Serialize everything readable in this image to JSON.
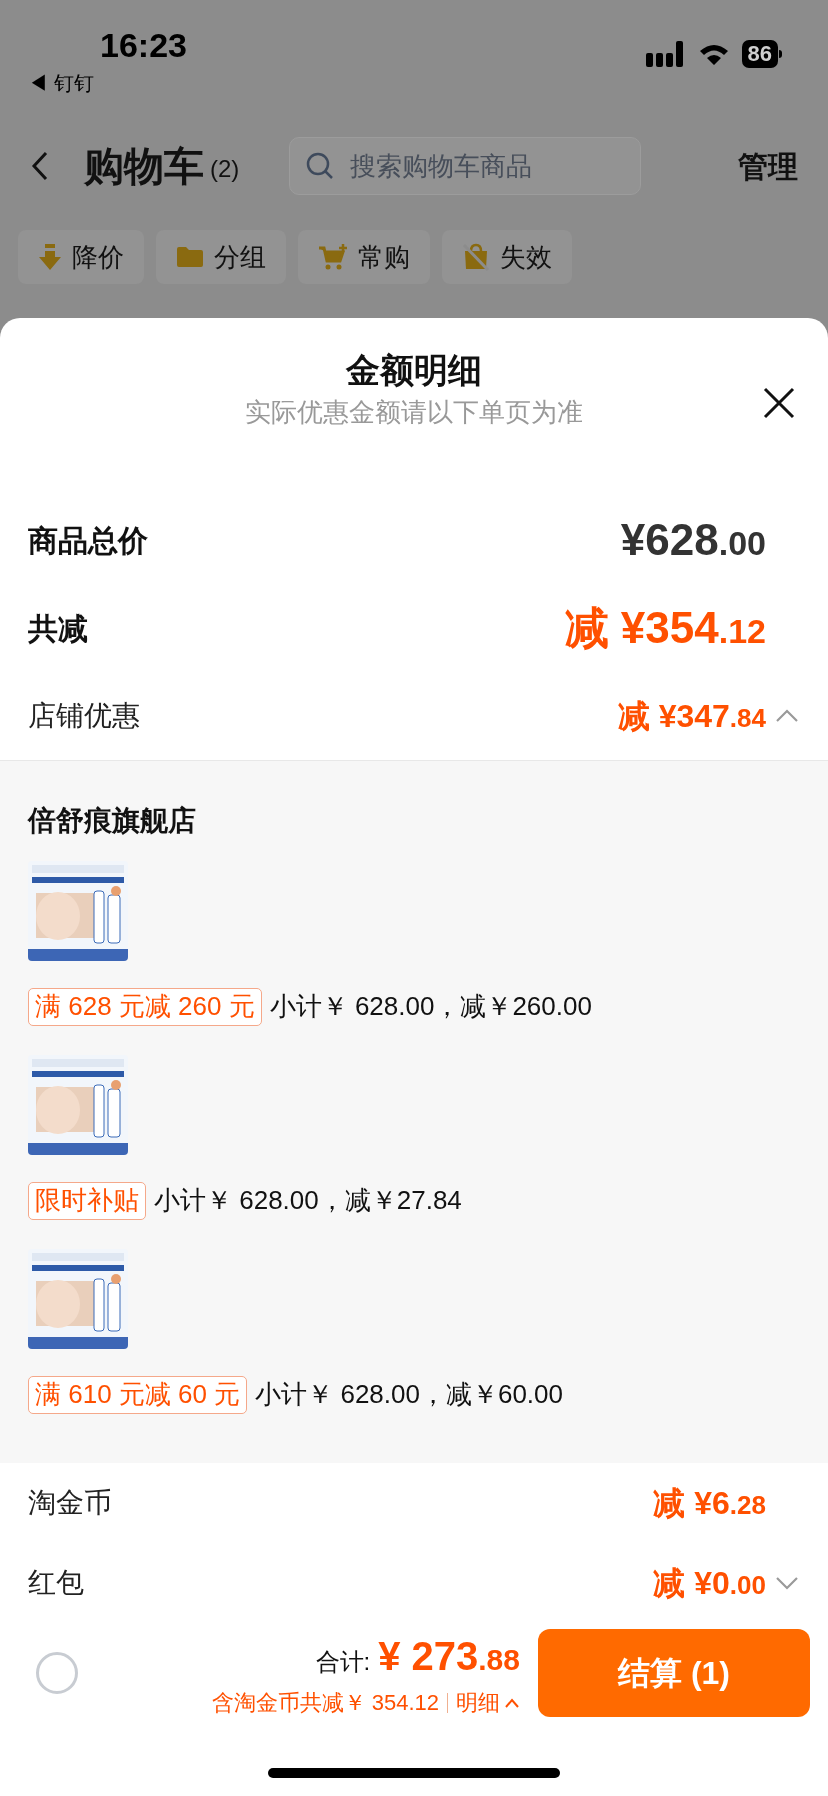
{
  "status_bar": {
    "time": "16:23",
    "back_app": "◀ 钉钉",
    "battery": "86"
  },
  "header": {
    "title": "购物车",
    "count": "(2)",
    "search": {
      "placeholder": "搜索购物车商品"
    },
    "manage": "管理"
  },
  "filters": [
    {
      "label": "降价",
      "kind": "down"
    },
    {
      "label": "分组",
      "kind": "folder"
    },
    {
      "label": "常购",
      "kind": "cart"
    },
    {
      "label": "失效",
      "kind": "invalid"
    }
  ],
  "sheet": {
    "title": "金额明细",
    "subtitle": "实际优惠金额请以下单页为准",
    "summary": [
      {
        "label": "商品总价",
        "amount": "¥628.00",
        "kind": "total"
      },
      {
        "label": "共减",
        "amount": "减 ¥354.12",
        "kind": "discount"
      },
      {
        "label": "店铺优惠",
        "amount": "减 ¥347.84",
        "kind": "sub",
        "expanded": true
      }
    ],
    "store": {
      "name": "倍舒痕旗舰店",
      "items": [
        {
          "kind": "picture",
          "tag": "满 628 元减 260 元",
          "subtotal": "小计￥ 628.00，减￥260.00"
        },
        {
          "kind": "picture",
          "tag": "限时补贴",
          "subtotal": "小计￥ 628.00，减￥27.84"
        },
        {
          "kind": "picture",
          "tag": "满 610 元减 60 元",
          "subtotal": "小计￥ 628.00，减￥60.00"
        }
      ]
    },
    "extra": [
      {
        "label": "淘金币",
        "amount": "减 ¥6.28"
      },
      {
        "label": "红包",
        "amount": "减 ¥0.00",
        "expanded": false
      }
    ]
  },
  "footer": {
    "checked": false,
    "total_label": "合计:",
    "total": "¥ 273.88",
    "savings": "含淘金币共减￥ 354.12",
    "detail": "明细",
    "detail_expanded": true,
    "checkout": "结算 (1)"
  }
}
